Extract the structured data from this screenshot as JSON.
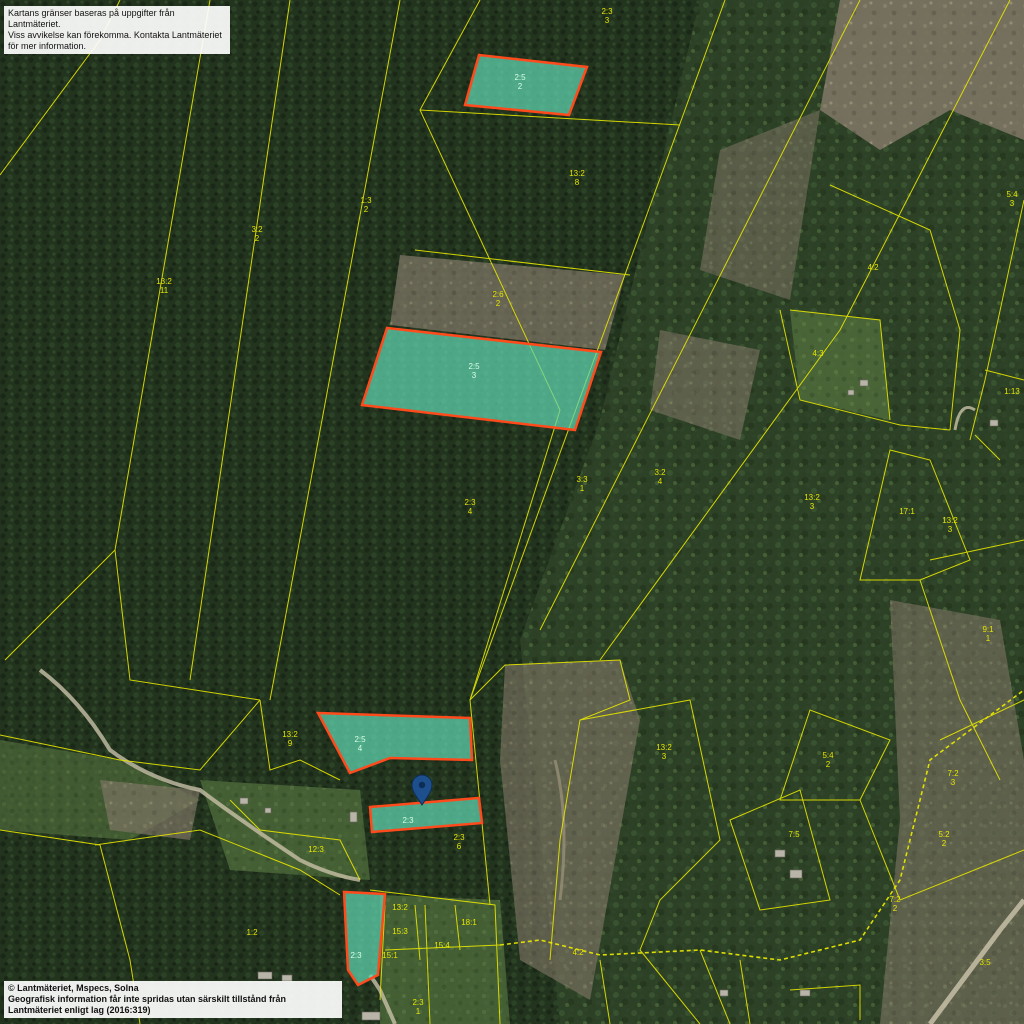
{
  "notices": {
    "top_line1": "Kartans gränser baseras på uppgifter från Lantmäteriet.",
    "top_line2": "Viss avvikelse kan förekomma. Kontakta Lantmäteriet för mer information.",
    "bottom_line1": "© Lantmäteriet, Mspecs, Solna",
    "bottom_line2": "Geografisk information får inte spridas utan särskilt tillstånd från Lantmäteriet enligt lag (2016:319)"
  },
  "colors": {
    "forest": "#23351f",
    "forest_light": "#3b5230",
    "clearing": "#8a7a62",
    "boundary": "#e6e600",
    "selected_fill": "#5fd6b0",
    "selected_stroke": "#ff4a1c",
    "road": "#c8c0a8",
    "pin": "#1d4f8c"
  },
  "marker": {
    "icon": "location-pin-icon"
  },
  "selected_parcels": [
    {
      "l1": "2:5",
      "l2": "2"
    },
    {
      "l1": "2:5",
      "l2": "3"
    },
    {
      "l1": "2:5",
      "l2": "4"
    },
    {
      "l1": "2:3",
      "l2": ""
    },
    {
      "l1": "2:3",
      "l2": ""
    }
  ],
  "parcel_labels": [
    {
      "l1": "2:3",
      "l2": "3"
    },
    {
      "l1": "13:2",
      "l2": "8"
    },
    {
      "l1": "1:3",
      "l2": "2"
    },
    {
      "l1": "3:2",
      "l2": "2"
    },
    {
      "l1": "13:2",
      "l2": "11"
    },
    {
      "l1": "2:6",
      "l2": "2"
    },
    {
      "l1": "2:3",
      "l2": "4"
    },
    {
      "l1": "3:3",
      "l2": "1"
    },
    {
      "l1": "3:2",
      "l2": "4"
    },
    {
      "l1": "13:2",
      "l2": "3"
    },
    {
      "l1": "4:2",
      "l2": ""
    },
    {
      "l1": "4:3",
      "l2": ""
    },
    {
      "l1": "5:4",
      "l2": "3"
    },
    {
      "l1": "17:1",
      "l2": ""
    },
    {
      "l1": "13:2",
      "l2": "3"
    },
    {
      "l1": "9:1",
      "l2": "1"
    },
    {
      "l1": "13:2",
      "l2": "9"
    },
    {
      "l1": "13:2",
      "l2": "3"
    },
    {
      "l1": "5:4",
      "l2": "2"
    },
    {
      "l1": "7:2",
      "l2": "3"
    },
    {
      "l1": "5:2",
      "l2": "2"
    },
    {
      "l1": "7:2",
      "l2": "2"
    },
    {
      "l1": "2:3",
      "l2": "6"
    },
    {
      "l1": "12:3",
      "l2": ""
    },
    {
      "l1": "1:2",
      "l2": ""
    },
    {
      "l1": "2:3",
      "l2": "1"
    },
    {
      "l1": "4:2",
      "l2": ""
    },
    {
      "l1": "7:5",
      "l2": ""
    },
    {
      "l1": "15:1",
      "l2": ""
    },
    {
      "l1": "13:2",
      "l2": ""
    },
    {
      "l1": "15:3",
      "l2": ""
    },
    {
      "l1": "15:4",
      "l2": ""
    },
    {
      "l1": "18:1",
      "l2": ""
    },
    {
      "l1": "3:5",
      "l2": ""
    },
    {
      "l1": "1:13",
      "l2": ""
    }
  ]
}
